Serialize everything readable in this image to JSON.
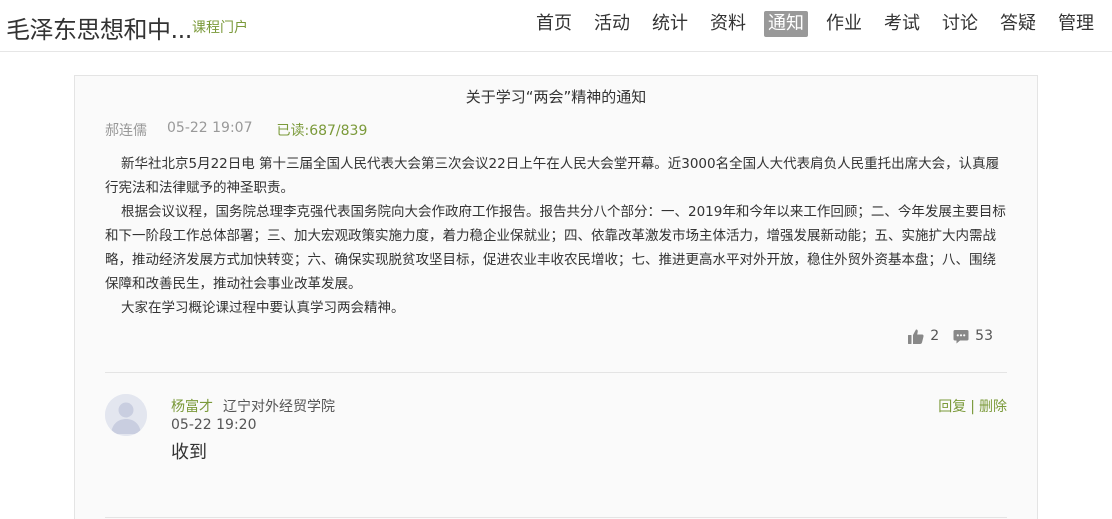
{
  "header": {
    "course_title": "毛泽东思想和中...",
    "portal_link": "课程门户",
    "nav": [
      {
        "label": "首页"
      },
      {
        "label": "活动"
      },
      {
        "label": "统计"
      },
      {
        "label": "资料"
      },
      {
        "label": "通知",
        "active": true
      },
      {
        "label": "作业"
      },
      {
        "label": "考试"
      },
      {
        "label": "讨论"
      },
      {
        "label": "答疑"
      },
      {
        "label": "管理"
      }
    ]
  },
  "notice": {
    "title": "关于学习“两会”精神的通知",
    "author": "郝连儒",
    "time": "05-22 19:07",
    "read_label": "已读:",
    "read_count": "687/839",
    "paragraphs": [
      "新华社北京5月22日电 第十三届全国人民代表大会第三次会议22日上午在人民大会堂开幕。近3000名全国人大代表肩负人民重托出席大会，认真履行宪法和法律赋予的神圣职责。",
      "根据会议议程，国务院总理李克强代表国务院向大会作政府工作报告。报告共分八个部分：一、2019年和今年以来工作回顾；二、今年发展主要目标和下一阶段工作总体部署；三、加大宏观政策实施力度，着力稳企业保就业；四、依靠改革激发市场主体活力，增强发展新动能；五、实施扩大内需战略，推动经济发展方式加快转变；六、确保实现脱贫攻坚目标，促进农业丰收农民增收；七、推进更高水平对外开放，稳住外贸外资基本盘；八、围绕保障和改善民生，推动社会事业改革发展。",
      " 大家在学习概论课过程中要认真学习两会精神。"
    ],
    "likes": "2",
    "comments": "53"
  },
  "reply": {
    "name": "杨富才",
    "school": "辽宁对外经贸学院",
    "time": "05-22 19:20",
    "text": "收到",
    "reply_label": "回复",
    "separator": "|",
    "delete_label": "删除"
  },
  "colors": {
    "accent_green": "#7b9a3a",
    "active_nav_bg": "#999999",
    "card_bg": "#fafafa"
  },
  "icons": {
    "like": "thumbs-up-icon",
    "comment": "comment-bubble-icon",
    "avatar": "default-avatar-icon"
  }
}
